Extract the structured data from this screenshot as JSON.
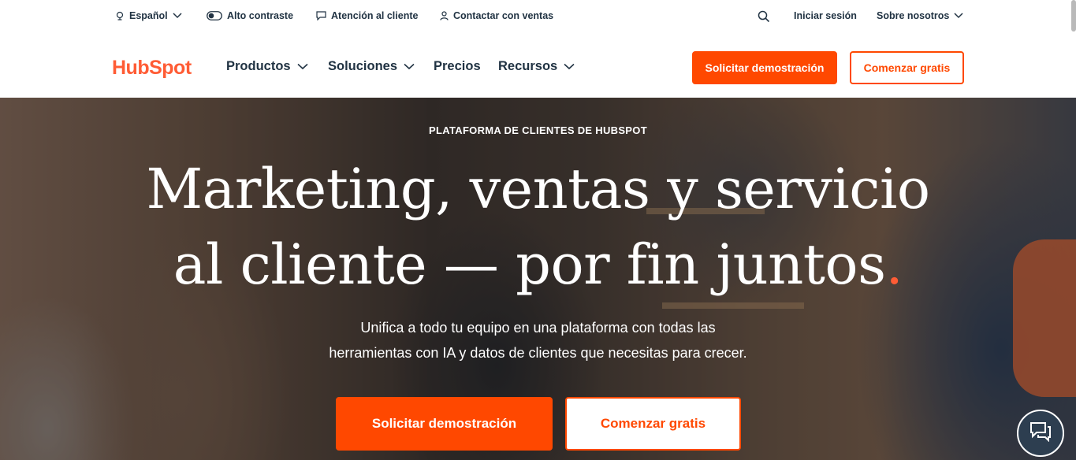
{
  "utility_bar": {
    "language_label": "Español",
    "contrast_label": "Alto contraste",
    "support_label": "Atención al cliente",
    "sales_label": "Contactar con ventas",
    "login_label": "Iniciar sesión",
    "about_label": "Sobre nosotros"
  },
  "main_nav": {
    "logo_text": "HubSpot",
    "items": [
      {
        "label": "Productos"
      },
      {
        "label": "Soluciones"
      },
      {
        "label": "Precios"
      },
      {
        "label": "Recursos"
      }
    ],
    "demo_button": "Solicitar demostración",
    "free_button": "Comenzar gratis"
  },
  "hero": {
    "eyebrow": "PLATAFORMA DE CLIENTES DE HUBSPOT",
    "headline_line1": "Marketing, ventas y servicio",
    "headline_line2": "al cliente — por fin juntos",
    "headline_dot": ".",
    "subtitle_line1": "Unifica a todo tu equipo en una plataforma con todas las",
    "subtitle_line2": "herramientas con IA y datos de clientes que necesitas para crecer.",
    "demo_button": "Solicitar demostración",
    "free_button": "Comenzar gratis"
  },
  "icons": {
    "language": "globe-icon",
    "contrast": "toggle-icon",
    "support": "chat-icon",
    "sales": "person-icon",
    "search": "search-icon",
    "chat_widget": "chat-bubbles-icon"
  },
  "colors": {
    "brand": "#ff5c35",
    "cta": "#ff4800",
    "text": "#213343",
    "chat_widget": "#2d3e50"
  }
}
